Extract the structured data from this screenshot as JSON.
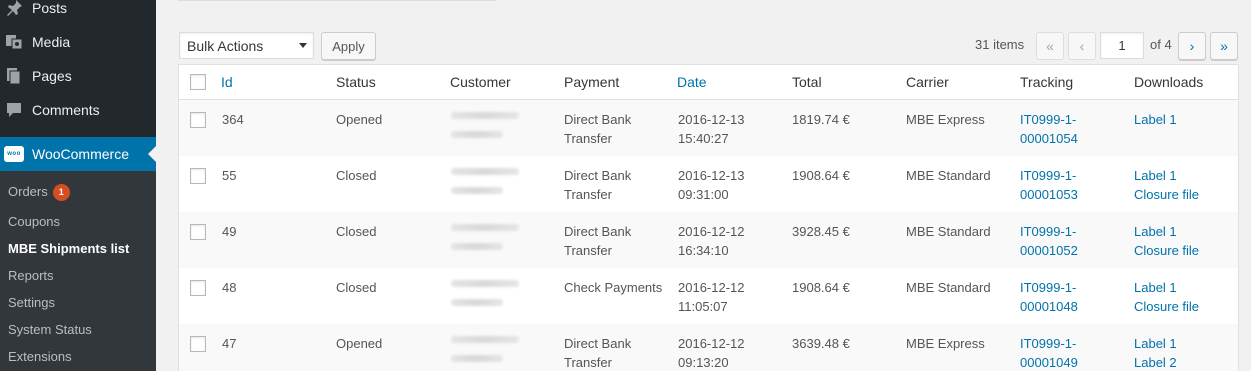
{
  "sidebar": {
    "items": [
      {
        "label": "Posts",
        "icon": "pin-icon"
      },
      {
        "label": "Media",
        "icon": "media-icon"
      },
      {
        "label": "Pages",
        "icon": "pages-icon"
      },
      {
        "label": "Comments",
        "icon": "comments-icon"
      }
    ],
    "woocommerce": {
      "label": "WooCommerce",
      "icon_text": "woo"
    },
    "submenu": [
      {
        "label": "Orders",
        "badge": "1"
      },
      {
        "label": "Coupons"
      },
      {
        "label": "MBE Shipments list"
      },
      {
        "label": "Reports"
      },
      {
        "label": "Settings"
      },
      {
        "label": "System Status"
      },
      {
        "label": "Extensions"
      }
    ]
  },
  "toolbar": {
    "bulk_actions": "Bulk Actions",
    "apply_label": "Apply"
  },
  "pagination": {
    "items_count": "31 items",
    "first": "«",
    "prev": "‹",
    "current_page": "1",
    "of_pages": "of 4",
    "next": "›",
    "last": "»"
  },
  "table": {
    "columns": [
      "Id",
      "Status",
      "Customer",
      "Payment",
      "Date",
      "Total",
      "Carrier",
      "Tracking",
      "Downloads"
    ],
    "rows": [
      {
        "id": "364",
        "status": "Opened",
        "payment": [
          "Direct Bank",
          "Transfer"
        ],
        "date": [
          "2016-12-13",
          "15:40:27"
        ],
        "total": "1819.74 €",
        "carrier": "MBE Express",
        "tracking": [
          "IT0999-1-",
          "00001054"
        ],
        "downloads": [
          "Label 1",
          ""
        ]
      },
      {
        "id": "55",
        "status": "Closed",
        "payment": [
          "Direct Bank",
          "Transfer"
        ],
        "date": [
          "2016-12-13",
          "09:31:00"
        ],
        "total": "1908.64 €",
        "carrier": "MBE Standard",
        "tracking": [
          "IT0999-1-",
          "00001053"
        ],
        "downloads": [
          "Label 1",
          "Closure file"
        ]
      },
      {
        "id": "49",
        "status": "Closed",
        "payment": [
          "Direct Bank",
          "Transfer"
        ],
        "date": [
          "2016-12-12",
          "16:34:10"
        ],
        "total": "3928.45 €",
        "carrier": "MBE Standard",
        "tracking": [
          "IT0999-1-",
          "00001052"
        ],
        "downloads": [
          "Label 1",
          "Closure file"
        ]
      },
      {
        "id": "48",
        "status": "Closed",
        "payment": [
          "Check Payments",
          ""
        ],
        "date": [
          "2016-12-12",
          "11:05:07"
        ],
        "total": "1908.64 €",
        "carrier": "MBE Standard",
        "tracking": [
          "IT0999-1-",
          "00001048"
        ],
        "downloads": [
          "Label 1",
          "Closure file"
        ]
      },
      {
        "id": "47",
        "status": "Opened",
        "payment": [
          "Direct Bank",
          "Transfer"
        ],
        "date": [
          "2016-12-12",
          "09:13:20"
        ],
        "total": "3639.48 €",
        "carrier": "MBE Express",
        "tracking": [
          "IT0999-1-",
          "00001049"
        ],
        "downloads": [
          "Label 1",
          "Label 2"
        ]
      }
    ]
  },
  "colors": {
    "accent": "#0073aa",
    "sidebar": "#23282d",
    "badge": "#d54e21"
  }
}
